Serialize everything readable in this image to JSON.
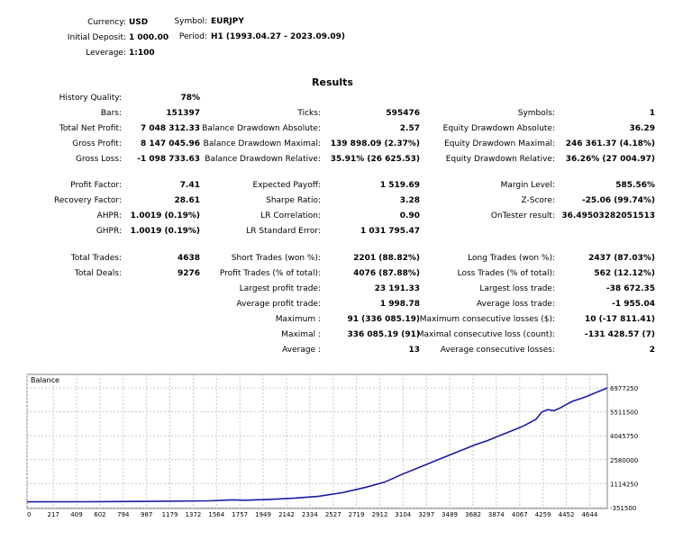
{
  "header": {
    "currency_label": "Currency:",
    "currency": "USD",
    "deposit_label": "Initial Deposit:",
    "deposit": "1 000.00",
    "leverage_label": "Leverage:",
    "leverage": "1:100",
    "symbol_label": "Symbol:",
    "symbol": "EURJPY",
    "period_label": "Period:",
    "period": "H1 (1993.04.27 - 2023.09.09)"
  },
  "results_title": "Results",
  "col1": {
    "history_quality_label": "History Quality:",
    "history_quality": "78%",
    "bars_label": "Bars:",
    "bars": "151397",
    "total_net_profit_label": "Total Net Profit:",
    "total_net_profit": "7 048 312.33",
    "gross_profit_label": "Gross Profit:",
    "gross_profit": "8 147 045.96",
    "gross_loss_label": "Gross Loss:",
    "gross_loss": "-1 098 733.63",
    "profit_factor_label": "Profit Factor:",
    "profit_factor": "7.41",
    "recovery_factor_label": "Recovery Factor:",
    "recovery_factor": "28.61",
    "ahpr_label": "AHPR:",
    "ahpr": "1.0019 (0.19%)",
    "ghpr_label": "GHPR:",
    "ghpr": "1.0019 (0.19%)",
    "total_trades_label": "Total Trades:",
    "total_trades": "4638",
    "total_deals_label": "Total Deals:",
    "total_deals": "9276"
  },
  "col2": {
    "ticks_label": "Ticks:",
    "ticks": "595476",
    "bal_dd_abs_label": "Balance Drawdown Absolute:",
    "bal_dd_abs": "2.57",
    "bal_dd_max_label": "Balance Drawdown Maximal:",
    "bal_dd_max": "139 898.09 (2.37%)",
    "bal_dd_rel_label": "Balance Drawdown Relative:",
    "bal_dd_rel": "35.91% (26 625.53)",
    "expected_payoff_label": "Expected Payoff:",
    "expected_payoff": "1 519.69",
    "sharpe_label": "Sharpe Ratio:",
    "sharpe": "3.28",
    "lr_corr_label": "LR Correlation:",
    "lr_corr": "0.90",
    "lr_std_label": "LR Standard Error:",
    "lr_std": "1 031 795.47",
    "short_trades_label": "Short Trades (won %):",
    "short_trades": "2201 (88.82%)",
    "profit_trades_label": "Profit Trades (% of total):",
    "profit_trades": "4076 (87.88%)",
    "largest_profit_label": "Largest profit trade:",
    "largest_profit": "23 191.33",
    "avg_profit_label": "Average profit trade:",
    "avg_profit": "1 998.78",
    "maximum_label": "Maximum :",
    "maximum": "91 (336 085.19)",
    "maximal_label": "Maximal :",
    "maximal": "336 085.19 (91)",
    "average_label": "Average :",
    "average": "13"
  },
  "col3": {
    "symbols_label": "Symbols:",
    "symbols": "1",
    "eq_dd_abs_label": "Equity Drawdown Absolute:",
    "eq_dd_abs": "36.29",
    "eq_dd_max_label": "Equity Drawdown Maximal:",
    "eq_dd_max": "246 361.37 (4.18%)",
    "eq_dd_rel_label": "Equity Drawdown Relative:",
    "eq_dd_rel": "36.26% (27 004.97)",
    "margin_level_label": "Margin Level:",
    "margin_level": "585.56%",
    "zscore_label": "Z-Score:",
    "zscore": "-25.06 (99.74%)",
    "ontester_label": "OnTester result:",
    "ontester": "36.49503282051513",
    "long_trades_label": "Long Trades (won %):",
    "long_trades": "2437 (87.03%)",
    "loss_trades_label": "Loss Trades (% of total):",
    "loss_trades": "562 (12.12%)",
    "largest_loss_label": "Largest loss trade:",
    "largest_loss": "-38 672.35",
    "avg_loss_label": "Average loss trade:",
    "avg_loss": "-1 955.04",
    "max_consec_losses_label": "Maximum consecutive losses ($):",
    "max_consec_losses": "10 (-17 811.41)",
    "maximal_consec_loss_label": "Maximal consecutive loss (count):",
    "maximal_consec_loss": "-131 428.57 (7)",
    "avg_consec_losses_label": "Average consecutive losses:",
    "avg_consec_losses": "2"
  },
  "chart_data": {
    "type": "line",
    "title": "Balance",
    "xlabel": "",
    "ylabel": "",
    "x_ticks": [
      "0",
      "217",
      "409",
      "602",
      "794",
      "987",
      "1179",
      "1372",
      "1564",
      "1757",
      "1949",
      "2142",
      "2334",
      "2527",
      "2719",
      "2912",
      "3104",
      "3297",
      "3489",
      "3682",
      "3874",
      "4067",
      "4259",
      "4452",
      "4644"
    ],
    "y_ticks": [
      "6977250",
      "5511500",
      "4045750",
      "2580000",
      "1114250",
      "-351500"
    ],
    "xlim": [
      0,
      4790
    ],
    "ylim": [
      -351500,
      6977250
    ],
    "series": [
      {
        "color": "#1a1aa8",
        "x": [
          0,
          500,
          1000,
          1500,
          1700,
          1800,
          2000,
          2200,
          2400,
          2600,
          2800,
          2950,
          3100,
          3250,
          3400,
          3550,
          3700,
          3800,
          3900,
          4000,
          4100,
          4200,
          4250,
          4300,
          4350,
          4400,
          4450,
          4500,
          4600,
          4700,
          4790
        ],
        "y": [
          1000,
          5000,
          30000,
          60000,
          120000,
          100000,
          150000,
          220000,
          330000,
          560000,
          900000,
          1200000,
          1700000,
          2150000,
          2600000,
          3050000,
          3500000,
          3750000,
          4050000,
          4350000,
          4650000,
          5050000,
          5500000,
          5650000,
          5580000,
          5750000,
          5950000,
          6150000,
          6400000,
          6700000,
          6977250
        ]
      }
    ]
  }
}
